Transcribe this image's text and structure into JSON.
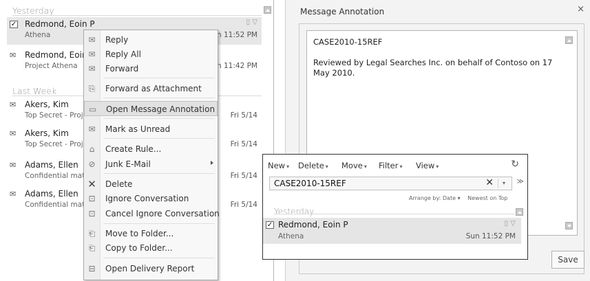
{
  "message_list": {
    "groups": [
      "Yesterday",
      "Last Week"
    ],
    "messages": [
      {
        "from": "Redmond, Eoin P",
        "subject": "Athena",
        "time": "Sun 11:52 PM",
        "flags": "▯ ▽",
        "icon": "check-icon"
      },
      {
        "from": "Redmond, Eoin P",
        "subject": "Project Athena",
        "time": "Sun 11:42 PM",
        "flags": "",
        "icon": "read-envelope-icon"
      },
      {
        "from": "Akers, Kim",
        "subject": "Top Secret - Project",
        "time": "Fri 5/14",
        "flags": "",
        "icon": "attachment-envelope-icon"
      },
      {
        "from": "Akers, Kim",
        "subject": "Top Secret - Project",
        "time": "Fri 5/14",
        "flags": "",
        "icon": "read-envelope-icon"
      },
      {
        "from": "Adams, Ellen",
        "subject": "Confidential material",
        "time": "Fri 5/14",
        "flags": "",
        "icon": "attachment-envelope-icon"
      },
      {
        "from": "Adams, Ellen",
        "subject": "Confidential material",
        "time": "Fri 5/14",
        "flags": "",
        "icon": "attachment-envelope-icon"
      }
    ]
  },
  "context_menu": {
    "items": [
      {
        "label": "Reply",
        "icon": "reply-icon",
        "glyph": "✉"
      },
      {
        "label": "Reply All",
        "icon": "reply-all-icon",
        "glyph": "✉"
      },
      {
        "label": "Forward",
        "icon": "forward-icon",
        "glyph": "✉"
      },
      {
        "label": "Forward as Attachment",
        "icon": "forward-attachment-icon",
        "glyph": "⎘"
      },
      {
        "label": "Open Message Annotation",
        "icon": "annotation-icon",
        "glyph": "▭"
      },
      {
        "label": "Mark as Unread",
        "icon": "unread-icon",
        "glyph": "✉"
      },
      {
        "label": "Create Rule...",
        "icon": "rule-icon",
        "glyph": "⌂"
      },
      {
        "label": "Junk E-Mail",
        "icon": "junk-icon",
        "glyph": "⊘"
      },
      {
        "label": "Delete",
        "icon": "delete-icon",
        "glyph": "✕"
      },
      {
        "label": "Ignore Conversation",
        "icon": "ignore-icon",
        "glyph": "⊡"
      },
      {
        "label": "Cancel Ignore Conversation",
        "icon": "cancel-ignore-icon",
        "glyph": "⊡"
      },
      {
        "label": "Move to Folder...",
        "icon": "move-folder-icon",
        "glyph": "⎗"
      },
      {
        "label": "Copy to Folder...",
        "icon": "copy-folder-icon",
        "glyph": "⎗"
      },
      {
        "label": "Open Delivery Report",
        "icon": "delivery-report-icon",
        "glyph": "⊟"
      }
    ]
  },
  "dialog": {
    "title": "Message Annotation",
    "close": "×",
    "annotation_text": "CASE2010-15REF\n\nReviewed by Legal Searches Inc. on behalf of Contoso on 17 May 2010.",
    "save_label": "Save"
  },
  "search_pane": {
    "toolbar": [
      {
        "label": "New"
      },
      {
        "label": "Delete"
      },
      {
        "label": "Move"
      },
      {
        "label": "Filter"
      },
      {
        "label": "View"
      }
    ],
    "search_value": "CASE2010-15REF",
    "arrange_by": "Arrange by: Date",
    "sort": "Newest on Top",
    "group": "Yesterday",
    "result": {
      "from": "Redmond, Eoin P",
      "subject": "Athena",
      "time": "Sun 11:52 PM",
      "flags": "▯ ▽"
    }
  }
}
